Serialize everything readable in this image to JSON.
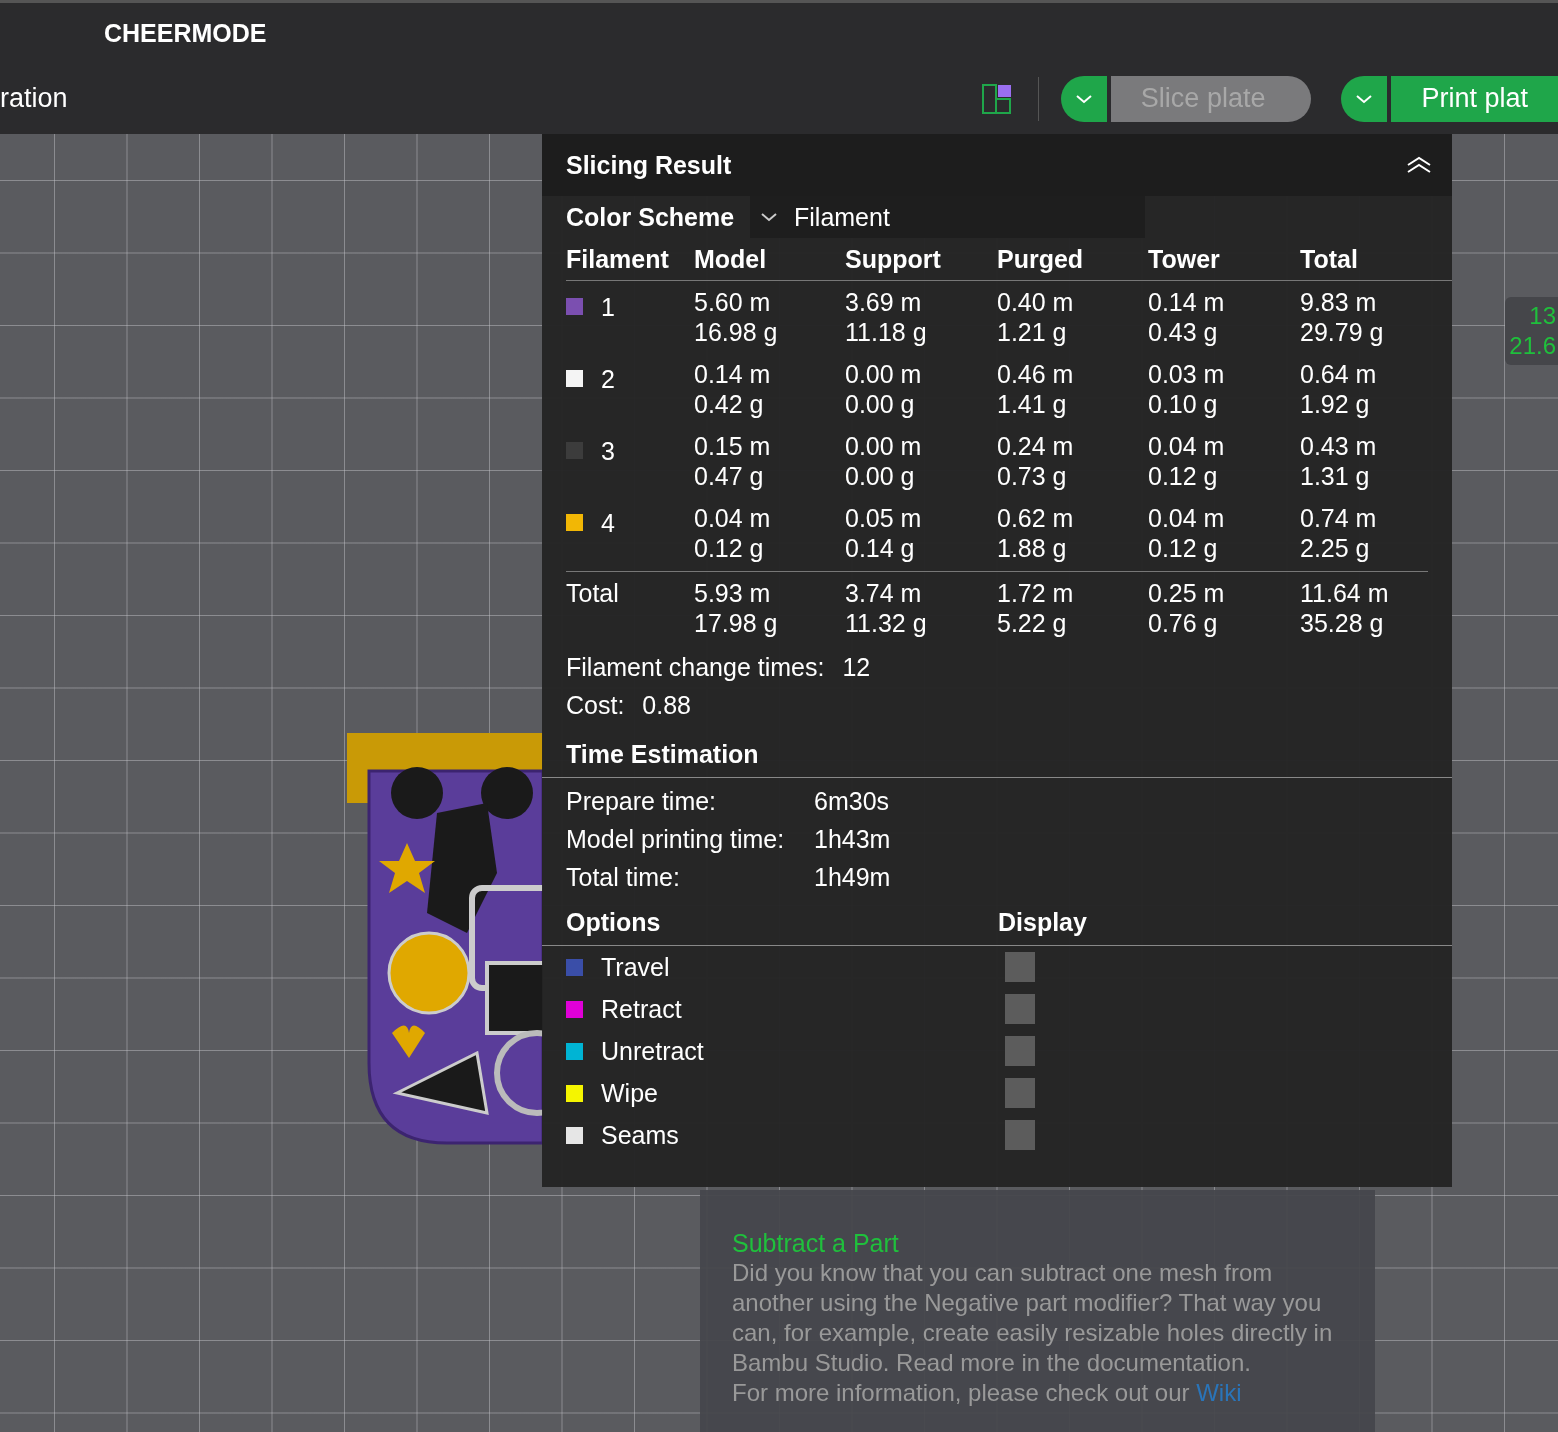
{
  "app": {
    "project_title": "CHEERMODE",
    "tab_label": "ration"
  },
  "toolbar": {
    "slice_button": {
      "label": "Slice plate",
      "disabled": true
    },
    "print_button": {
      "label": "Print plat",
      "disabled": false
    }
  },
  "slicing_result": {
    "title": "Slicing Result",
    "color_scheme": {
      "label": "Color Scheme",
      "value": "Filament"
    },
    "columns": [
      "Filament",
      "Model",
      "Support",
      "Purged",
      "Tower",
      "Total"
    ],
    "filaments": [
      {
        "id": "1",
        "color": "#7b4fb0",
        "cells": [
          [
            "5.60 m",
            "16.98 g"
          ],
          [
            "3.69 m",
            "11.18 g"
          ],
          [
            "0.40 m",
            "1.21 g"
          ],
          [
            "0.14 m",
            "0.43 g"
          ],
          [
            "9.83 m",
            "29.79 g"
          ]
        ]
      },
      {
        "id": "2",
        "color": "#f4f4f4",
        "cells": [
          [
            "0.14 m",
            "0.42 g"
          ],
          [
            "0.00 m",
            "0.00 g"
          ],
          [
            "0.46 m",
            "1.41 g"
          ],
          [
            "0.03 m",
            "0.10 g"
          ],
          [
            "0.64 m",
            "1.92 g"
          ]
        ]
      },
      {
        "id": "3",
        "color": "#3c3c3c",
        "cells": [
          [
            "0.15 m",
            "0.47 g"
          ],
          [
            "0.00 m",
            "0.00 g"
          ],
          [
            "0.24 m",
            "0.73 g"
          ],
          [
            "0.04 m",
            "0.12 g"
          ],
          [
            "0.43 m",
            "1.31 g"
          ]
        ]
      },
      {
        "id": "4",
        "color": "#f2b705",
        "cells": [
          [
            "0.04 m",
            "0.12 g"
          ],
          [
            "0.05 m",
            "0.14 g"
          ],
          [
            "0.62 m",
            "1.88 g"
          ],
          [
            "0.04 m",
            "0.12 g"
          ],
          [
            "0.74 m",
            "2.25 g"
          ]
        ]
      }
    ],
    "total": {
      "label": "Total",
      "cells": [
        [
          "5.93 m",
          "17.98 g"
        ],
        [
          "3.74 m",
          "11.32 g"
        ],
        [
          "1.72 m",
          "5.22 g"
        ],
        [
          "0.25 m",
          "0.76 g"
        ],
        [
          "11.64 m",
          "35.28 g"
        ]
      ]
    },
    "stats": [
      {
        "label": "Filament change times:",
        "value": "12"
      },
      {
        "label": "Cost:",
        "value": "0.88"
      }
    ],
    "time": {
      "title": "Time Estimation",
      "rows": [
        {
          "label": "Prepare time:",
          "value": "6m30s"
        },
        {
          "label": "Model printing time:",
          "value": "1h43m"
        },
        {
          "label": "Total time:",
          "value": "1h49m"
        }
      ]
    },
    "options": {
      "title": "Options",
      "display_title": "Display",
      "items": [
        {
          "name": "Travel",
          "color": "#3a4ea8",
          "checked": false
        },
        {
          "name": "Retract",
          "color": "#e000d8",
          "checked": false
        },
        {
          "name": "Unretract",
          "color": "#00b4d4",
          "checked": false
        },
        {
          "name": "Wipe",
          "color": "#f5f500",
          "checked": false
        },
        {
          "name": "Seams",
          "color": "#e6e6e6",
          "checked": false
        }
      ]
    }
  },
  "side_readout": [
    "13",
    "21.6"
  ],
  "tip": {
    "title": "Subtract a Part",
    "body": "Did you know that you can subtract one mesh from another using the Negative part modifier? That way you can, for example, create easily resizable holes directly in Bambu Studio. Read more in the documentation.",
    "footer": "For more information, please check out our",
    "link": "Wiki"
  }
}
